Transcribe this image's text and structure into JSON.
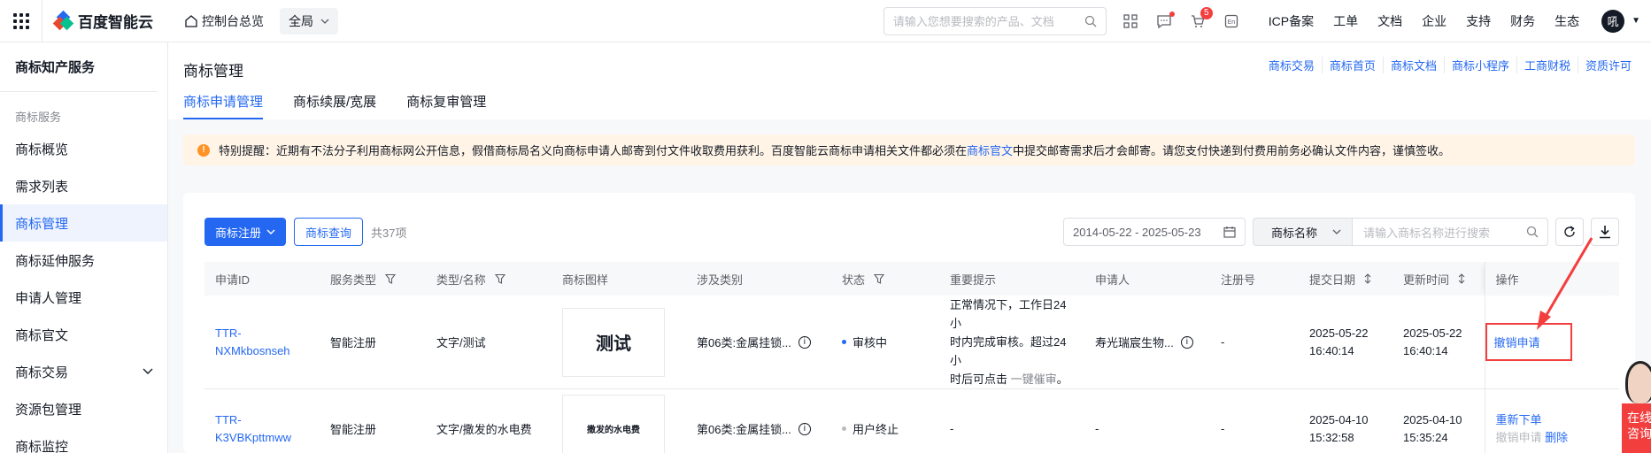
{
  "topbar": {
    "brand": "百度智能云",
    "console_label": "控制台总览",
    "region": "全局",
    "search_placeholder": "请输入您想要搜索的产品、文档",
    "cart_badge": "5",
    "links": [
      "ICP备案",
      "工单",
      "文档",
      "企业",
      "支持",
      "财务",
      "生态"
    ],
    "avatar_text": "吼"
  },
  "sidebar": {
    "title": "商标知产服务",
    "group_label": "商标服务",
    "items": [
      {
        "label": "商标概览"
      },
      {
        "label": "需求列表"
      },
      {
        "label": "商标管理"
      },
      {
        "label": "商标延伸服务"
      },
      {
        "label": "申请人管理"
      },
      {
        "label": "商标官文"
      },
      {
        "label": "商标交易"
      },
      {
        "label": "资源包管理"
      },
      {
        "label": "商标监控"
      }
    ]
  },
  "header": {
    "title": "商标管理",
    "quick_links": [
      "商标交易",
      "商标首页",
      "商标文档",
      "商标小程序",
      "工商财税",
      "资质许可"
    ],
    "tabs": [
      "商标申请管理",
      "商标续展/宽展",
      "商标复审管理"
    ]
  },
  "notice": {
    "text_before": "特别提醒：近期有不法分子利用商标网公开信息，假借商标局名义向商标申请人邮寄到付文件收取费用获利。百度智能云商标申请相关文件都必须在",
    "link": "商标官文",
    "text_after": "中提交邮寄需求后才会邮寄。请您支付快递到付费用前务必确认文件内容，谨慎签收。"
  },
  "toolbar": {
    "register_label": "商标注册",
    "query_label": "商标查询",
    "total_text": "共37项",
    "date_range": "2014-05-22 - 2025-05-23",
    "name_select": "商标名称",
    "name_placeholder": "请输入商标名称进行搜索"
  },
  "table": {
    "headers": [
      "申请ID",
      "服务类型",
      "类型/名称",
      "商标图样",
      "涉及类别",
      "状态",
      "重要提示",
      "申请人",
      "注册号",
      "提交日期",
      "更新时间",
      "操作"
    ],
    "rows": [
      {
        "id_line1": "TTR-",
        "id_line2": "NXMkbosnseh",
        "service": "智能注册",
        "type_name": "文字/测试",
        "image_text": "测试",
        "category": "第06类:金属挂锁...",
        "status": "审核中",
        "status_color": "#2468f2",
        "hint_line1": "正常情况下，工作日24小",
        "hint_line2": "时内完成审核。超过24小",
        "hint_line3_a": "时后可点击",
        "hint_line3_b": "一键催审",
        "hint_line3_c": "。",
        "applicant": "寿光瑞宸生物...",
        "reg_no": "-",
        "submit_date": "2025-05-22",
        "submit_time": "16:40:14",
        "update_date": "2025-05-22",
        "update_time": "16:40:14",
        "op": "撤销申请"
      },
      {
        "id_line1": "TTR-",
        "id_line2": "K3VBKpttmww",
        "service": "智能注册",
        "type_name": "文字/撒发的水电费",
        "image_text": "撒发的水电费",
        "category": "第06类:金属挂锁...",
        "status": "用户终止",
        "status_color": "#b8babf",
        "hint": "-",
        "applicant": "-",
        "reg_no": "-",
        "submit_date": "2025-04-10",
        "submit_time": "15:32:58",
        "update_date": "2025-04-10",
        "update_time": "15:35:24",
        "op_reorder": "重新下单",
        "op_cancel": "撤销申请",
        "op_delete": "删除"
      }
    ]
  },
  "service_float": {
    "line1": "在线",
    "line2": "咨询"
  }
}
